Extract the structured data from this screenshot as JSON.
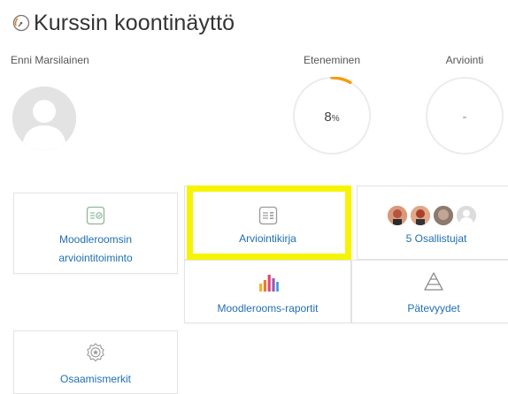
{
  "header": {
    "title": "Kurssin koontinäyttö",
    "icon": "dashboard-gauge-icon"
  },
  "user": {
    "name": "Enni Marsilainen"
  },
  "stats": {
    "progress": {
      "label": "Eteneminen",
      "value": "8",
      "unit": "%",
      "fraction": 0.08,
      "color": "#f39c12"
    },
    "grade": {
      "label": "Arviointi",
      "value": "-"
    }
  },
  "tiles": {
    "grading_tool": {
      "label_line1": "Moodleroomsin",
      "label_line2": "arviointitoiminto",
      "icon": "grading-tool-icon"
    },
    "gradebook": {
      "label": "Arviointikirja",
      "icon": "gradebook-icon"
    },
    "participants": {
      "label": "5 Osallistujat",
      "icon": "participants-avatars"
    },
    "reports": {
      "label": "Moodlerooms-raportit",
      "icon": "reports-chart-icon"
    },
    "competencies": {
      "label": "Pätevyydet",
      "icon": "competencies-pyramid-icon"
    },
    "badges": {
      "label": "Osaamismerkit",
      "icon": "badge-icon"
    }
  },
  "colors": {
    "link": "#1f6fb5",
    "highlight": "#f6f400",
    "progress": "#f39c12"
  }
}
